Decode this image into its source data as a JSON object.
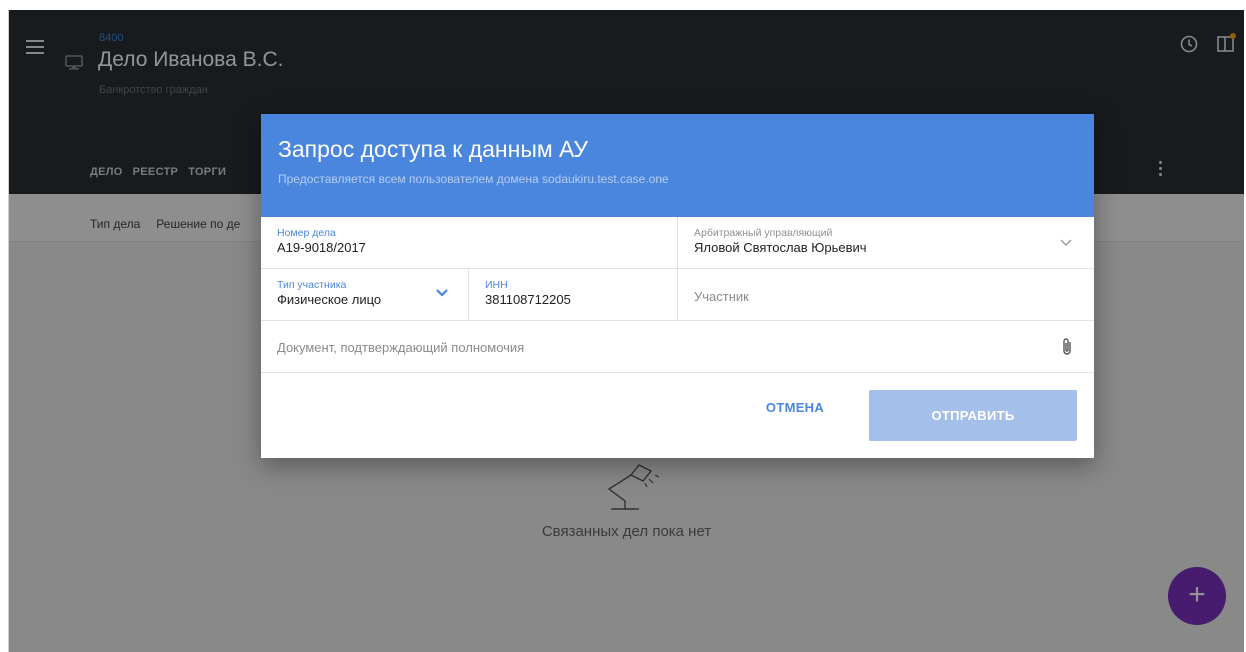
{
  "app": {
    "case_number": "8400",
    "case_title": "Дело Иванова В.С.",
    "case_subtitle": "Банкротство граждан",
    "tabs": [
      "ДЕЛО",
      "РЕЕСТР",
      "ТОРГИ"
    ],
    "subtabs": [
      "Тип дела",
      "Решение по де"
    ],
    "icons": {
      "menu": "hamburger-menu-icon",
      "monitor": "monitor-icon",
      "clock": "clock-icon",
      "layout": "layout-icon",
      "more": "kebab-menu-icon",
      "add": "plus-icon"
    },
    "empty_state_text": "Связанных дел пока нет",
    "fab_label": "+"
  },
  "dialog": {
    "title": "Запрос доступа к данным АУ",
    "subtitle": "Предоставляется всем пользователем домена sodaukiru.test.case.one",
    "fields": {
      "case_number": {
        "label": "Номер дела",
        "value": "А19-9018/2017"
      },
      "manager": {
        "label": "Арбитражный управляющий",
        "value": "Яловой Святослав  Юрьевич"
      },
      "participant_type": {
        "label": "Тип участника",
        "value": "Физическое лицо"
      },
      "inn": {
        "label": "ИНН",
        "value": "381108712205"
      },
      "participant": {
        "placeholder": "Участник"
      },
      "document": {
        "placeholder": "Документ, подтверждающий полномочия"
      }
    },
    "buttons": {
      "cancel": "ОТМЕНА",
      "submit": "ОТПРАВИТЬ"
    }
  },
  "colors": {
    "appbar": "#2a2f34",
    "accent": "#4a86dd",
    "submit_disabled": "#a4c0ea",
    "fab": "#7b2fbe"
  }
}
